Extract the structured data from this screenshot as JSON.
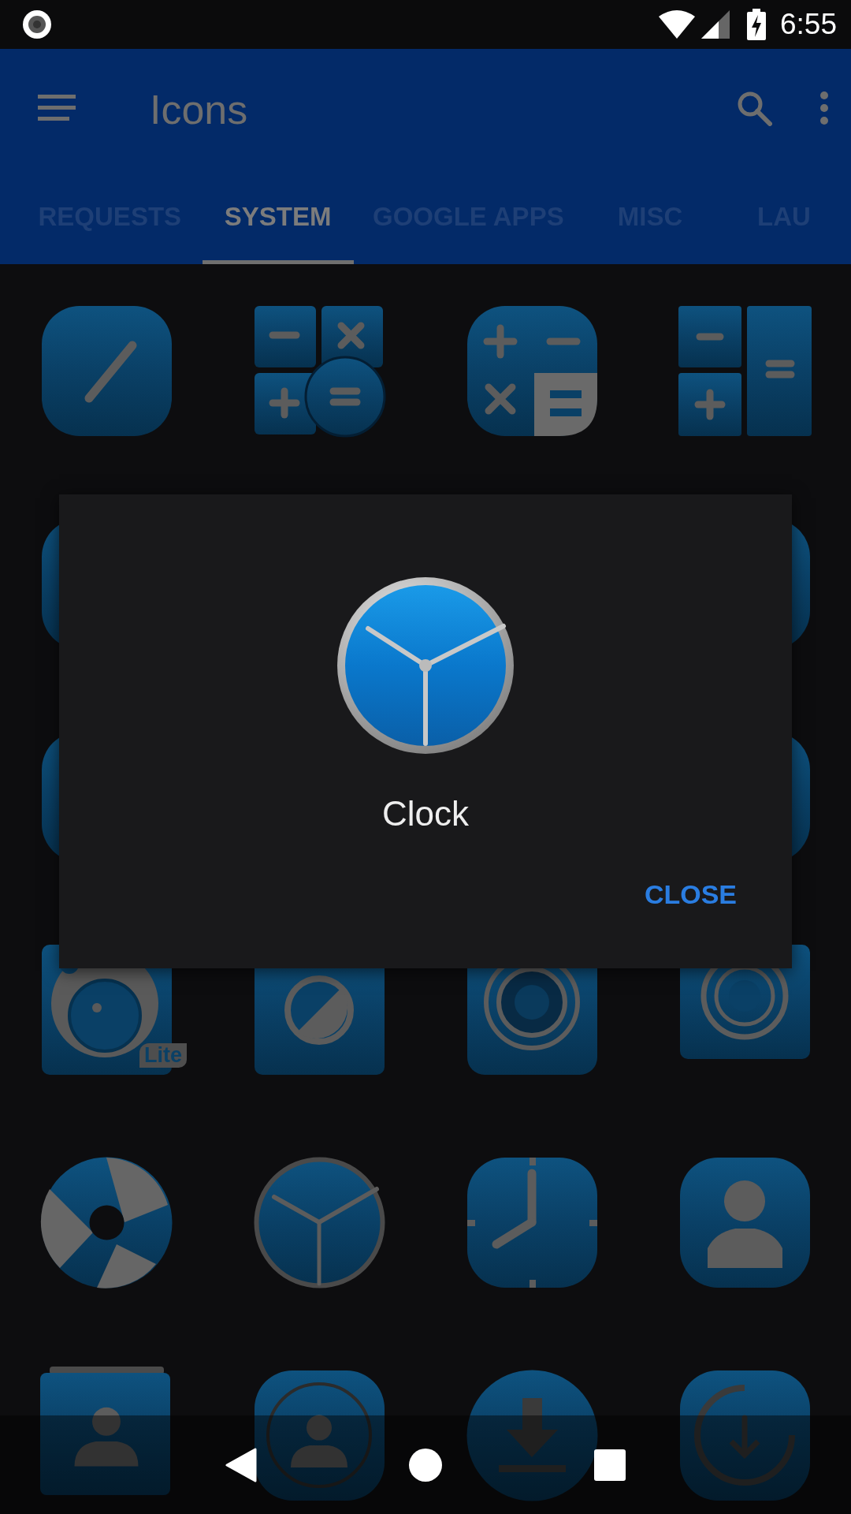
{
  "status_bar": {
    "time": "6:55"
  },
  "app_bar": {
    "title": "Icons"
  },
  "tabs": [
    {
      "label": "REQUESTS",
      "selected": false
    },
    {
      "label": "SYSTEM",
      "selected": true
    },
    {
      "label": "GOOGLE APPS",
      "selected": false
    },
    {
      "label": "MISC",
      "selected": false
    },
    {
      "label": "LAU",
      "selected": false
    }
  ],
  "icon_grid": [
    [
      {
        "kind": "pencil"
      },
      {
        "kind": "calc-grid"
      },
      {
        "kind": "calc-round"
      },
      {
        "kind": "calc-split"
      }
    ],
    [
      {
        "kind": "tile"
      },
      {
        "kind": "tile"
      }
    ],
    [
      {
        "kind": "tile"
      },
      {
        "kind": "tile"
      }
    ],
    [
      {
        "kind": "camera",
        "badge": "Lite"
      },
      {
        "kind": "exposure"
      },
      {
        "kind": "lens"
      },
      {
        "kind": "speaker"
      }
    ],
    [
      {
        "kind": "aperture"
      },
      {
        "kind": "clock"
      },
      {
        "kind": "alarm"
      },
      {
        "kind": "contact"
      }
    ],
    [
      {
        "kind": "contact-card"
      },
      {
        "kind": "contact-circle"
      },
      {
        "kind": "download"
      },
      {
        "kind": "download-circle"
      }
    ]
  ],
  "dialog": {
    "title": "Clock",
    "button": "CLOSE"
  }
}
